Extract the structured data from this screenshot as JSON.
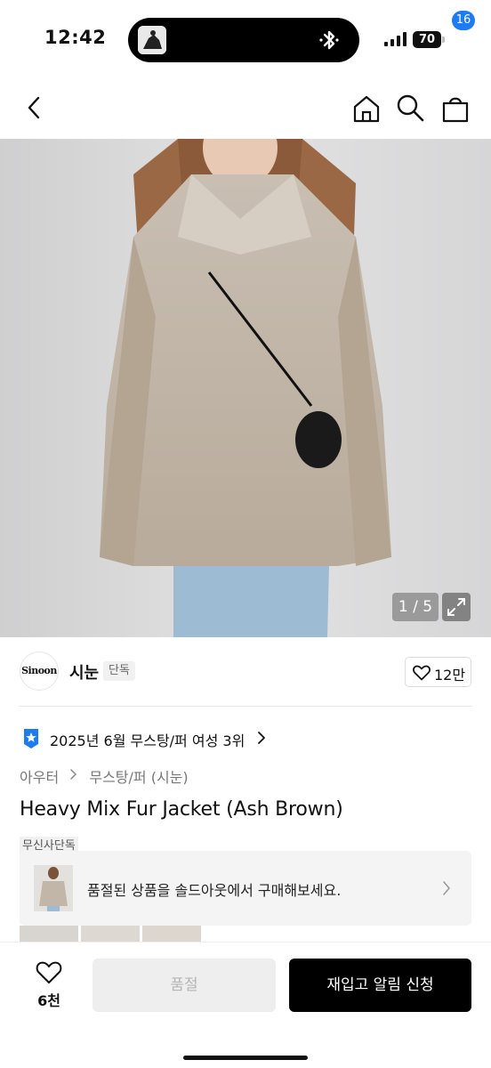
{
  "status_bar": {
    "time": "12:42",
    "battery": "70",
    "icons": [
      "signal-icon",
      "bluetooth-icon",
      "battery-icon"
    ]
  },
  "header": {
    "icons": [
      "back-arrow-icon",
      "home-icon",
      "search-icon",
      "cart-icon"
    ],
    "cart_badge": "16"
  },
  "gallery": {
    "counter": "1 / 5",
    "expand_icon": "expand-icon"
  },
  "brand": {
    "logo_text": "Sinoon",
    "name": "시눈",
    "tag": "단독",
    "like_count": "12만"
  },
  "ranking": {
    "text": "2025년 6월 무스탕/퍼 여성 3위",
    "icon": "star-badge-icon"
  },
  "breadcrumb": {
    "level1": "아우터",
    "level2": "무스탕/퍼 (시눈)"
  },
  "product": {
    "title": "Heavy Mix Fur Jacket (Ash Brown)",
    "exclusive_tag": "무신사단독"
  },
  "soldout_banner": {
    "text": "품절된 상품을 솔드아웃에서 구매해보세요."
  },
  "bottom_bar": {
    "wish_count": "6천",
    "soldout_label": "품절",
    "restock_label": "재입고 알림 신청"
  },
  "colors": {
    "accent_blue": "#1e7cf2",
    "primary_black": "#000000",
    "disabled_gray": "#eeeeee"
  }
}
